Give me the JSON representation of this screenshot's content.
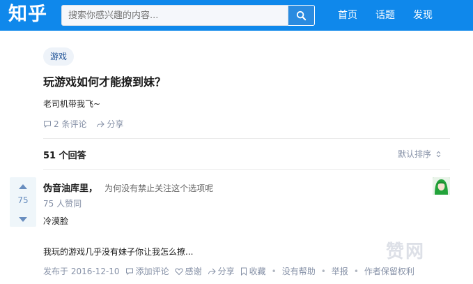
{
  "header": {
    "logo": "知乎",
    "search_placeholder": "搜索你感兴趣的内容...",
    "nav": [
      "首页",
      "话题",
      "发现"
    ]
  },
  "question": {
    "topic": "游戏",
    "title": "玩游戏如何才能撩到妹？",
    "detail": "老司机带我飞~",
    "comments": "2 条评论",
    "share": "分享"
  },
  "answers_header": {
    "count": "51 个回答",
    "sort": "默认排序"
  },
  "answer": {
    "votes": "75",
    "author": "伪音油库里，",
    "bio": "为何没有禁止关注这个选项呢",
    "upvoters": "75 人赞同",
    "text": "冷漠脸",
    "excerpt": "我玩的游戏几乎没有妹子你让我怎么撩...",
    "meta": {
      "published": "发布于 2016-12-10",
      "comment": "添加评论",
      "thanks": "感谢",
      "share": "分享",
      "collect": "收藏",
      "no_help": "没有帮助",
      "report": "举报",
      "copyright": "作者保留权利"
    }
  },
  "watermark": "赞网"
}
